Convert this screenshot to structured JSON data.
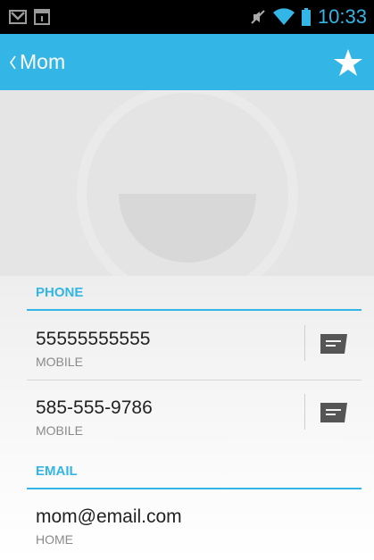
{
  "status_bar": {
    "left_icons": [
      "gmail-icon",
      "calendar-icon"
    ],
    "right_icons": [
      "mute-icon",
      "wifi-icon",
      "battery-icon"
    ],
    "time": "10:33",
    "accent_color": "#33b5e5"
  },
  "action_bar": {
    "title": "Mom",
    "background_color": "#33b5e5",
    "back_icon": "chevron-left-icon",
    "favorite_icon": "star-icon"
  },
  "photo": {
    "icon": "default-contact-avatar-icon"
  },
  "sections": {
    "phone": {
      "label": "PHONE",
      "entries": [
        {
          "value": "55555555555",
          "type": "MOBILE",
          "action_icon": "message-icon"
        },
        {
          "value": "585-555-9786",
          "type": "MOBILE",
          "action_icon": "message-icon"
        }
      ]
    },
    "email": {
      "label": "EMAIL",
      "entries": [
        {
          "value": "mom@email.com",
          "type": "HOME"
        }
      ]
    }
  }
}
